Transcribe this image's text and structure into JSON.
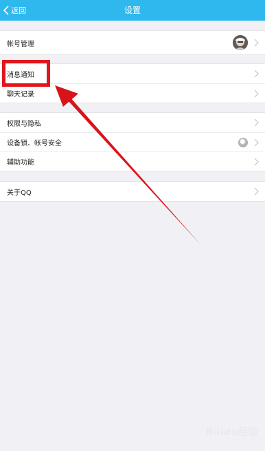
{
  "navbar": {
    "back_label": "返回",
    "title": "设置"
  },
  "group1": {
    "items": [
      {
        "label": "帐号管理"
      }
    ]
  },
  "group2": {
    "items": [
      {
        "label": "消息通知"
      },
      {
        "label": "聊天记录"
      }
    ]
  },
  "group3": {
    "items": [
      {
        "label": "权限与隐私"
      },
      {
        "label": "设备锁、帐号安全"
      },
      {
        "label": "辅助功能"
      }
    ]
  },
  "group4": {
    "items": [
      {
        "label": "关于QQ"
      }
    ]
  },
  "watermark": {
    "text": "Baidu经验"
  },
  "colors": {
    "nav_bg": "#2fb8ee",
    "highlight": "#e1161d",
    "page_bg": "#f1f1f5"
  }
}
